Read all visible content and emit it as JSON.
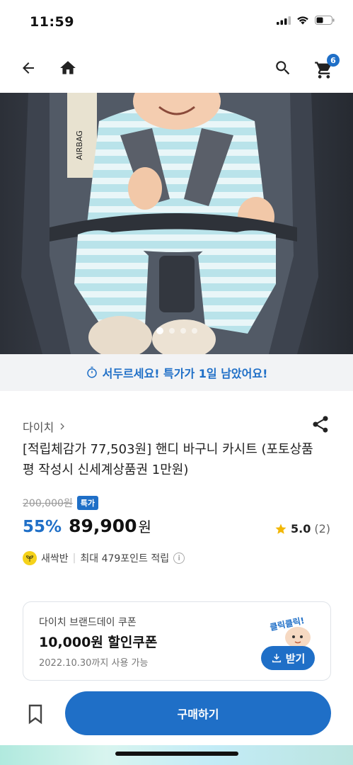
{
  "status_bar": {
    "time": "11:59"
  },
  "nav": {
    "cart_count": "6"
  },
  "hero": {
    "image_name": "product-photo",
    "dots": 4,
    "active_dot": 0
  },
  "urgency": {
    "text": "서두르세요! 특가가 1일 남았어요!"
  },
  "product": {
    "brand": "다이치",
    "title": "[적립체감가 77,503원] 핸디 바구니 카시트 (포토상품평 작성시 신세계상품권 1만원)",
    "original_price": "200,000원",
    "special_badge": "특가",
    "discount": "55%",
    "price": "89,900",
    "currency": "원",
    "rating": "5.0",
    "review_count": "(2)"
  },
  "points": {
    "grade": "새싹반",
    "text": "최대 479포인트 적립"
  },
  "coupon": {
    "brand_text": "다이치 브랜드데이 쿠폰",
    "amount": "10,000원 할인쿠폰",
    "valid_until": "2022.10.30까지 사용 가능",
    "button_label": "받기",
    "deco_text": "클릭클릭!"
  },
  "bottom_bar": {
    "buy_label": "구매하기"
  },
  "colors": {
    "accent": "#1f6fc7",
    "star": "#f2b705",
    "grade": "#f5d21a"
  }
}
